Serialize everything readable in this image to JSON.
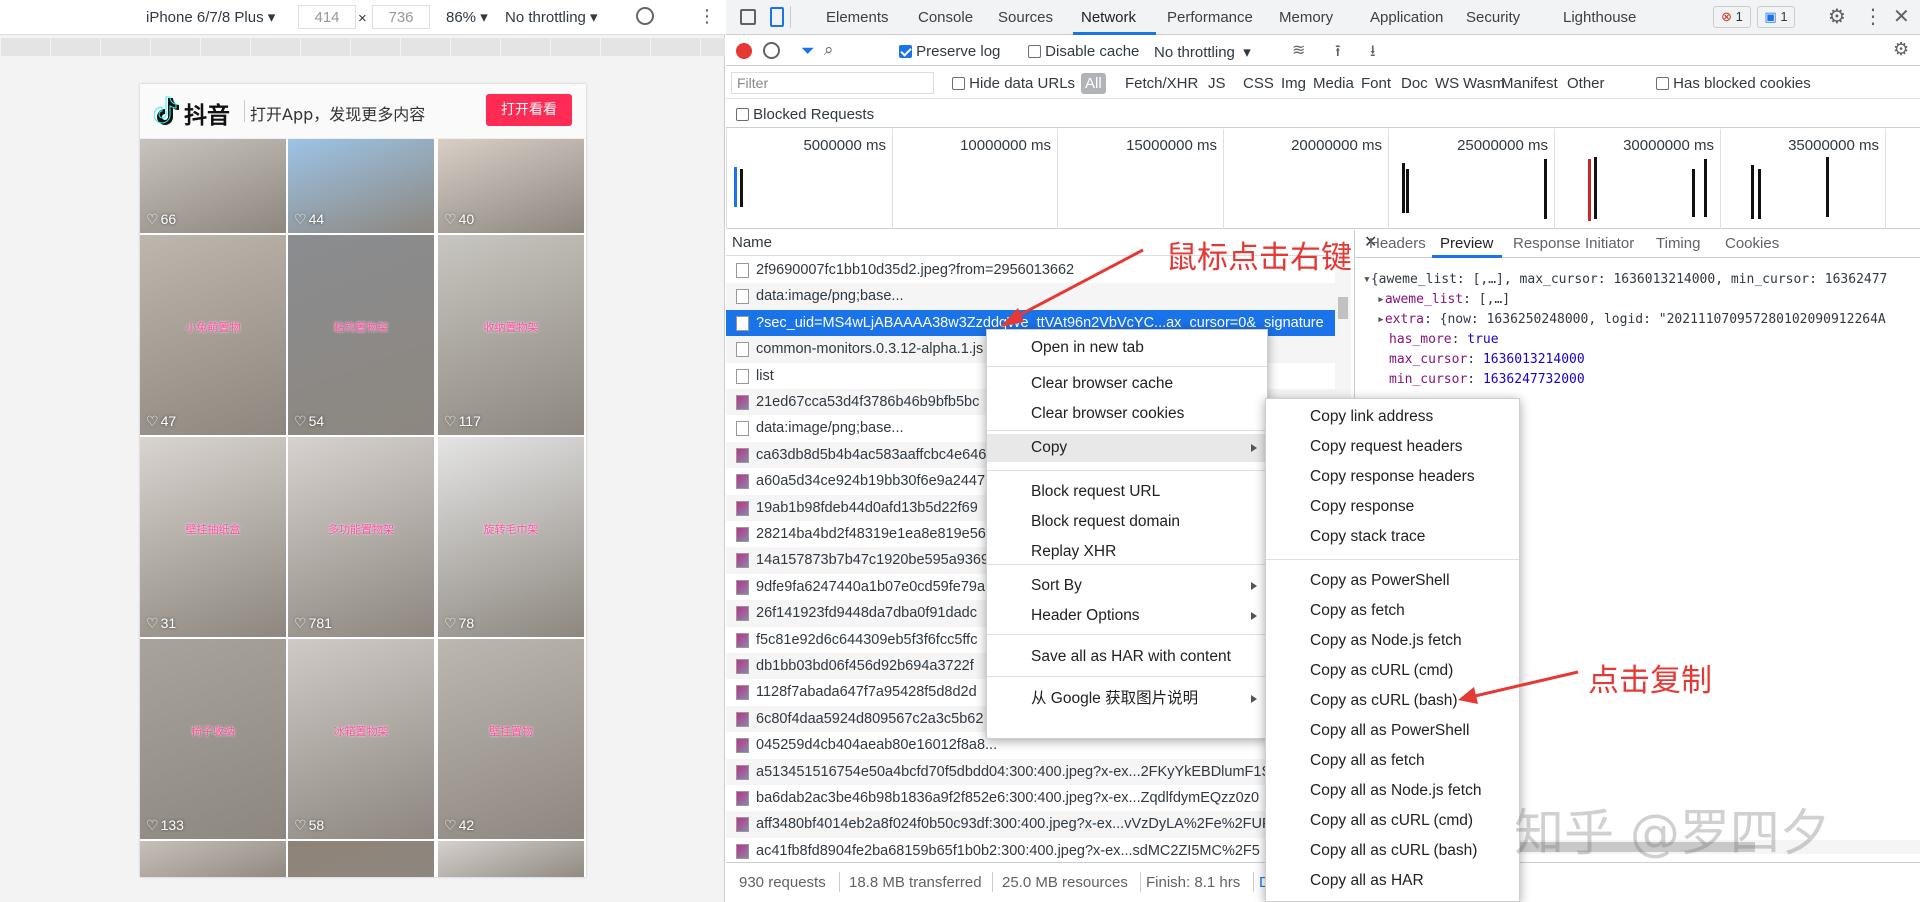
{
  "device_toolbar": {
    "device": "iPhone 6/7/8 Plus",
    "width": "414",
    "times": "×",
    "height": "736",
    "zoom": "86%",
    "throttling": "No throttling"
  },
  "douyin": {
    "logo": "抖音",
    "slogan": "打开App，发现更多内容",
    "open_button": "打开看看",
    "cells": [
      {
        "likes": "66",
        "color": "#c9c3bd"
      },
      {
        "likes": "44",
        "color": "#9cc3e6"
      },
      {
        "likes": "40",
        "color": "#d8cfc7"
      },
      {
        "likes": "47",
        "color": "#bfb6ad",
        "tag": "小兔萌置物"
      },
      {
        "likes": "54",
        "color": "#8a8c90",
        "tag": "粘钩置物架"
      },
      {
        "likes": "117",
        "color": "#c8c6c0",
        "tag": "收纳置物架"
      },
      {
        "likes": "31",
        "color": "#d9d4cf",
        "tag": "壁挂抽纸盒"
      },
      {
        "likes": "781",
        "color": "#d7d2cf",
        "tag": "多功能置物架"
      },
      {
        "likes": "78",
        "color": "#e4e4e4",
        "tag": "旋转毛巾架"
      },
      {
        "likes": "133",
        "color": "#a8a39b",
        "tag": "椅子收纳"
      },
      {
        "likes": "58",
        "color": "#cfcac6",
        "tag": "冰箱置物架"
      },
      {
        "likes": "42",
        "color": "#bdb7b1",
        "tag": "壁挂置物"
      },
      {
        "likes": "",
        "color": "#c6c0b9"
      },
      {
        "likes": "",
        "color": "#8f8378"
      },
      {
        "likes": "",
        "color": "#d5d0cc"
      }
    ]
  },
  "devtools": {
    "tabs": [
      "Elements",
      "Console",
      "Sources",
      "Network",
      "Performance",
      "Memory",
      "Application",
      "Security",
      "Lighthouse"
    ],
    "active_tab": "Network",
    "error_count": "1",
    "message_count": "1",
    "toolbar": {
      "preserve_log": "Preserve log",
      "disable_cache": "Disable cache",
      "throttling": "No throttling"
    },
    "filter": {
      "placeholder": "Filter",
      "hide_data_urls": "Hide data URLs",
      "types": [
        "All",
        "Fetch/XHR",
        "JS",
        "CSS",
        "Img",
        "Media",
        "Font",
        "Doc",
        "WS",
        "Wasm",
        "Manifest",
        "Other"
      ],
      "has_blocked_cookies": "Has blocked cookies",
      "blocked_requests": "Blocked Requests"
    },
    "timeline_labels": [
      "5000000 ms",
      "10000000 ms",
      "15000000 ms",
      "20000000 ms",
      "25000000 ms",
      "30000000 ms",
      "35000000 ms"
    ],
    "name_header": "Name",
    "requests": [
      "2f9690007fc1bb10d35d2.jpeg?from=2956013662",
      "data:image/png;base...",
      "?sec_uid=MS4wLjABAAAA38w3ZzddqWe_ttVAt96n2VbVcYC...ax_cursor=0&_signature",
      "common-monitors.0.3.12-alpha.1.js",
      "list",
      "21ed67cca53d4f3786b46b9bfb5bc",
      "data:image/png;base...",
      "ca63db8d5b4b4ac583aaffcbc4e646",
      "a60a5d34ce924b19bb30f6e9a2447",
      "19ab1b98fdeb44d0afd13b5d22f69",
      "28214ba4bd2f48319e1ea8e819e56",
      "14a157873b7b47c1920be595a9369",
      "9dfe9fa6247440a1b07e0cd59fe79a",
      "26f141923fd9448da7dba0f91dadc",
      "f5c81e92d6c644309eb5f3f6fcc5ffc",
      "db1bb03bd06f456d92b694a3722f",
      "1128f7abada647f7a95428f5d8d2d",
      "6c80f4daa5924d809567c2a3c5b62",
      "045259d4cb404aeab80e16012f8a8...",
      "a513451516754e50a4bcfd70f5dbdd04:300:400.jpeg?x-ex...2FKyYkEBDlumF1S",
      "ba6dab2ac3be46b98b1836a9f2f852e6:300:400.jpeg?x-ex...ZqdlfdymEQzz0z0",
      "aff3480bf4014eb2a8f024f0b50c93df:300:400.jpeg?x-ex...vVzDyLA%2Fe%2FUF",
      "ac41fb8fd8904fe2ba68159b65f1b0b2:300:400.jpeg?x-ex...sdMC2ZI5MC%2F5"
    ],
    "detail_tabs": [
      "Headers",
      "Preview",
      "Response",
      "Initiator",
      "Timing",
      "Cookies"
    ],
    "active_detail_tab": "Preview",
    "preview": {
      "line1": "{aweme_list: [,…], max_cursor: 1636013214000, min_cursor: 16362477",
      "aweme_key": "aweme_list",
      "aweme_val": "[,…]",
      "extra_key": "extra",
      "extra_val": "{now: 1636250248000, logid: \"202111070957280102090912264A",
      "has_more_key": "has_more",
      "has_more_val": "true",
      "max_cursor_key": "max_cursor",
      "max_cursor_val": "1636013214000",
      "min_cursor_key": "min_cursor",
      "min_cursor_val": "1636247732000"
    },
    "status": {
      "requests": "930 requests",
      "transferred": "18.8 MB transferred",
      "resources": "25.0 MB resources",
      "finish": "Finish: 8.1 hrs",
      "extra": "D"
    }
  },
  "context_menu": {
    "items": [
      "Open in new tab",
      "Clear browser cache",
      "Clear browser cookies",
      "Copy",
      "Block request URL",
      "Block request domain",
      "Replay XHR",
      "Sort By",
      "Header Options",
      "Save all as HAR with content",
      "从 Google 获取图片说明"
    ]
  },
  "copy_submenu": {
    "items": [
      "Copy link address",
      "Copy request headers",
      "Copy response headers",
      "Copy response",
      "Copy stack trace",
      "Copy as PowerShell",
      "Copy as fetch",
      "Copy as Node.js fetch",
      "Copy as cURL (cmd)",
      "Copy as cURL (bash)",
      "Copy all as PowerShell",
      "Copy all as fetch",
      "Copy all as Node.js fetch",
      "Copy all as cURL (cmd)",
      "Copy all as cURL (bash)",
      "Copy all as HAR"
    ]
  },
  "annotations": {
    "right_click": "鼠标点击右键",
    "click_copy": "点击复制",
    "watermark": "知乎 @罗四夕"
  },
  "colors": {
    "accent": "#1a73e8",
    "record": "#e53935",
    "douyin_button": "#fe2c55",
    "annotation": "#e53935"
  }
}
